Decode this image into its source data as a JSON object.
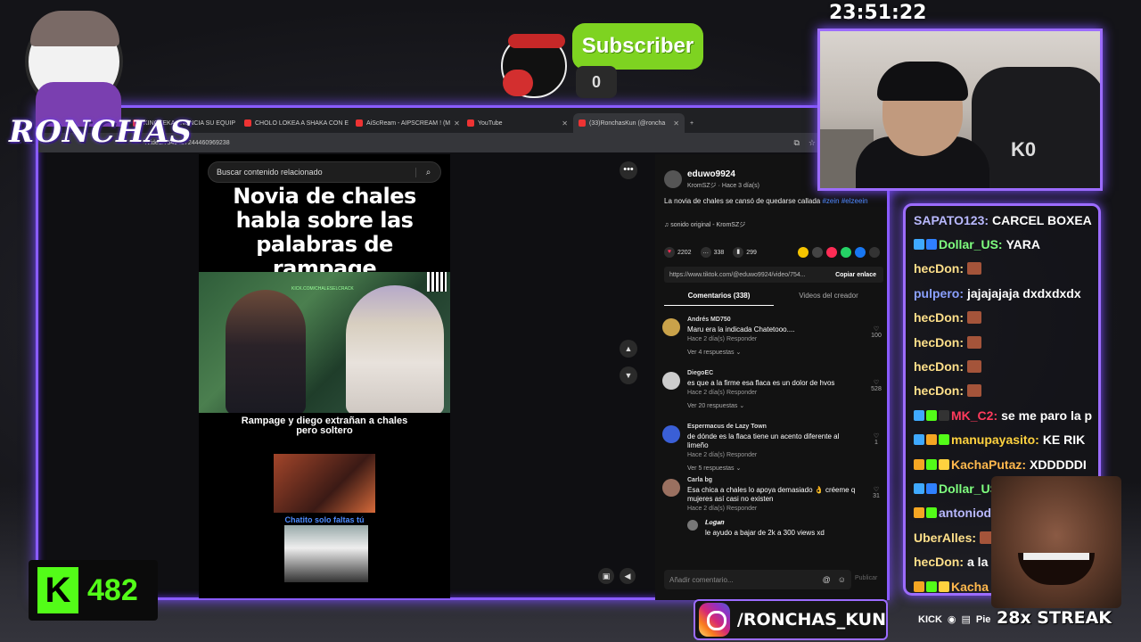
{
  "clock": "23:51:22",
  "logo": {
    "text": "RONCHAS"
  },
  "subscriber": {
    "label": "Subscriber",
    "count": "0"
  },
  "browser": {
    "tabs": [
      {
        "label": "KINGTEKA ANUNCIA SU EQUIP",
        "active": false
      },
      {
        "label": "CHOLO LOKEA A SHAKA CON E",
        "active": false
      },
      {
        "label": "AiScReam - AIPSCREAM ! (M",
        "active": false
      },
      {
        "label": "YouTube",
        "active": false
      },
      {
        "label": "(33)RonchasKun (@roncha",
        "active": true
      }
    ],
    "new_tab": "+",
    "url": "/video/7549427244460969238"
  },
  "video": {
    "search_placeholder": "Buscar contenido relacionado",
    "title": "Novia de chales habla sobre las palabras de rampage",
    "kick_tag": "KICK.COM/CHALESELCRACK",
    "caption": "Rampage y diego extrañan a chales pero soltero",
    "thumb_label": "Chatito solo faltas tú"
  },
  "details": {
    "username": "eduwo9924",
    "meta": "KromSZジ · Hace 3 día(s)",
    "description": "La novia de chales se cansó de quedarse callada",
    "hashtags": "#zein #elzeein",
    "sound": "♫  sonido original - KromSZジ",
    "likes": "2202",
    "comments_count": "338",
    "saves": "299",
    "link": "https://www.tiktok.com/@eduwo9924/video/754...",
    "copy_link": "Copiar enlace",
    "tab_comments": "Comentarios (338)",
    "tab_videos": "Videos del creador",
    "comments": [
      {
        "user": "Andrés MD750",
        "text": "Maru era la indicada Chatetooo....",
        "meta": "Hace 2 día(s)   Responder",
        "likes": "100",
        "more": "Ver 4 respuestas ⌄"
      },
      {
        "user": "DiegoEC",
        "text": "es que a la firme esa flaca es un dolor de hvos",
        "meta": "Hace 2 día(s)   Responder",
        "likes": "528",
        "more": "Ver 20 respuestas ⌄"
      },
      {
        "user": "Espermacus de Lazy Town",
        "text": "de dónde es la flaca tiene un acento diferente al limeño",
        "meta": "Hace 2 día(s)   Responder",
        "likes": "1",
        "more": "Ver 5 respuestas ⌄"
      },
      {
        "user": "Carla bg",
        "text": "Esa chica a chales lo apoya demasiado 👌 créeme q mujeres así casi no existen",
        "meta": "Hace 2 día(s)   Responder",
        "likes": "31",
        "more": ""
      }
    ],
    "reply": {
      "user": "𝑳𝒐𝒈𝒂𝒏",
      "text": "le ayudo a bajar de 2k a 300 views xd"
    },
    "comment_placeholder": "Añadir comentario...",
    "publish": "Publicar"
  },
  "chat": [
    {
      "user": "SAPATO123:",
      "text": "CARCEL BOXEA",
      "color": "#b9b9ff",
      "badges": []
    },
    {
      "user": "Dollar_US:",
      "text": "YARA",
      "color": "#7fff7f",
      "badges": [
        "#3fa9ff",
        "#2f80ff"
      ]
    },
    {
      "user": "hecDon:",
      "text": "",
      "color": "#ffe08a",
      "badges": [],
      "emote": true
    },
    {
      "user": "pulpero:",
      "text": "jajajajaja dxdxdxdx",
      "color": "#8aa0ff",
      "badges": []
    },
    {
      "user": "hecDon:",
      "text": "",
      "color": "#ffe08a",
      "badges": [],
      "emote": true
    },
    {
      "user": "hecDon:",
      "text": "",
      "color": "#ffe08a",
      "badges": [],
      "emote": true
    },
    {
      "user": "hecDon:",
      "text": "",
      "color": "#ffe08a",
      "badges": [],
      "emote": true
    },
    {
      "user": "hecDon:",
      "text": "",
      "color": "#ffe08a",
      "badges": [],
      "emote": true
    },
    {
      "user": "MK_C2:",
      "text": "se me paro la p",
      "color": "#ff3b5c",
      "badges": [
        "#3fa9ff",
        "#53fc18",
        "#333"
      ]
    },
    {
      "user": "manupayasito:",
      "text": "KE RIK",
      "color": "#ffd23f",
      "badges": [
        "#3fa9ff",
        "#f5a623",
        "#53fc18"
      ]
    },
    {
      "user": "KachaPutaz:",
      "text": "XDDDDDI",
      "color": "#ffb84d",
      "badges": [
        "#f5a623",
        "#53fc18",
        "#ffd23f"
      ]
    },
    {
      "user": "Dollar_US",
      "text": "",
      "color": "#7fff7f",
      "badges": [
        "#3fa9ff",
        "#2f80ff"
      ]
    },
    {
      "user": "antoniod",
      "text": "",
      "color": "#b9b9ff",
      "badges": [
        "#f5a623",
        "#53fc18"
      ]
    },
    {
      "user": "UberAlles:",
      "text": "",
      "color": "#ffe08a",
      "badges": [],
      "emote": true
    },
    {
      "user": "hecDon:",
      "text": "a la",
      "color": "#ffe08a",
      "badges": []
    },
    {
      "user": "Kacha",
      "text": "",
      "color": "#ffb84d",
      "badges": [
        "#f5a623",
        "#53fc18",
        "#ffd23f"
      ]
    }
  ],
  "streak": "28x STREAK",
  "socials": {
    "kick": "KICK",
    "rest": "Pie"
  },
  "kick_counter": {
    "logo": "K",
    "count": "482"
  },
  "instagram": {
    "handle": "/RONCHAS_KUN"
  },
  "colors": {
    "accent": "#9c6cff",
    "kick_green": "#53fc18",
    "subscriber_green": "#7ed321"
  }
}
